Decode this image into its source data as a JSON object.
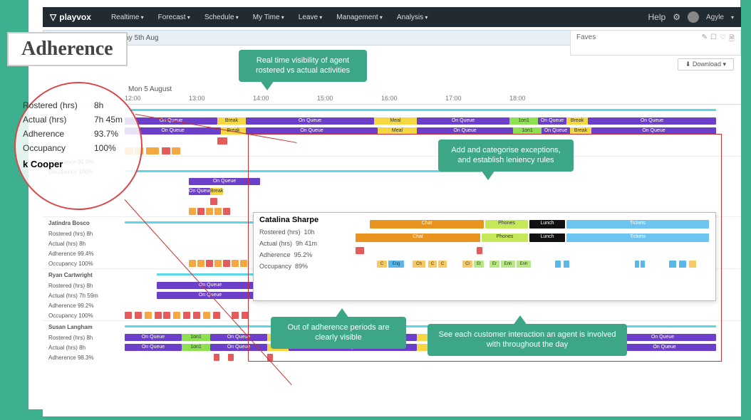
{
  "page_title": "Adherence",
  "brand": "playvox",
  "nav": {
    "items": [
      "Realtime",
      "Forecast",
      "Schedule",
      "My Time",
      "Leave",
      "Management",
      "Analysis"
    ],
    "help": "Help",
    "user": "Agyle"
  },
  "date_range": "Monday 5th Aug - Monday 5th Aug",
  "faves": {
    "label": "Faves"
  },
  "download": "Download",
  "timeline": {
    "date": "Mon 5 August",
    "hours": [
      "12:00",
      "13:00",
      "14:00",
      "15:00",
      "16:00",
      "17:00",
      "18:00"
    ]
  },
  "stats_highlight": {
    "rostered_label": "Rostered (hrs)",
    "rostered_val": "8h",
    "actual_label": "Actual (hrs)",
    "actual_val": "7h 45m",
    "adherence_label": "Adherence",
    "adherence_val": "93.7%",
    "occupancy_label": "Occupancy",
    "occupancy_val": "100%",
    "agent_name": "k Cooper"
  },
  "agents": [
    {
      "name": "",
      "rows": {
        "adherence": "92.5%",
        "occupancy": "100%"
      }
    },
    {
      "name": "Jatindra Bosco",
      "rows": {
        "rostered": "8h",
        "actual": "8h",
        "adherence": "99.4%",
        "occupancy": "100%"
      }
    },
    {
      "name": "Ryan Cartwright",
      "rows": {
        "rostered": "8h",
        "actual": "7h 59m",
        "adherence": "99.2%",
        "occupancy": "100%"
      }
    },
    {
      "name": "Susan Langham",
      "rows": {
        "rostered": "8h",
        "actual": "8h",
        "adherence": "98.3%"
      }
    }
  ],
  "field_labels": {
    "rostered": "Rostered (hrs)",
    "actual": "Actual (hrs)",
    "adherence": "Adherence",
    "occupancy": "Occupancy"
  },
  "bars": {
    "onqueue": "On Queue",
    "break": "Break",
    "meal": "Meal",
    "ton": "1on1"
  },
  "detail": {
    "name": "Catalina Sharpe",
    "rostered": "10h",
    "actual": "9h 41m",
    "adherence": "95.2%",
    "occupancy": "89%",
    "activities": {
      "chat": "Chat",
      "phones": "Phones",
      "lunch": "Lunch",
      "tickets": "Tickets"
    },
    "chips": {
      "c": "C",
      "ch": "Ch",
      "eng": "Eng",
      "cl": "Cl",
      "et": "Et",
      "er": "Er",
      "enh": "Enh"
    }
  },
  "callouts": {
    "c1": "Real time visibility of agent rostered vs actual activities",
    "c2": "Add and categorise exceptions, and establish leniency rules",
    "c3": "Out of adherence periods are clearly visible",
    "c4": "See each customer interaction an agent is involved with throughout the day"
  }
}
